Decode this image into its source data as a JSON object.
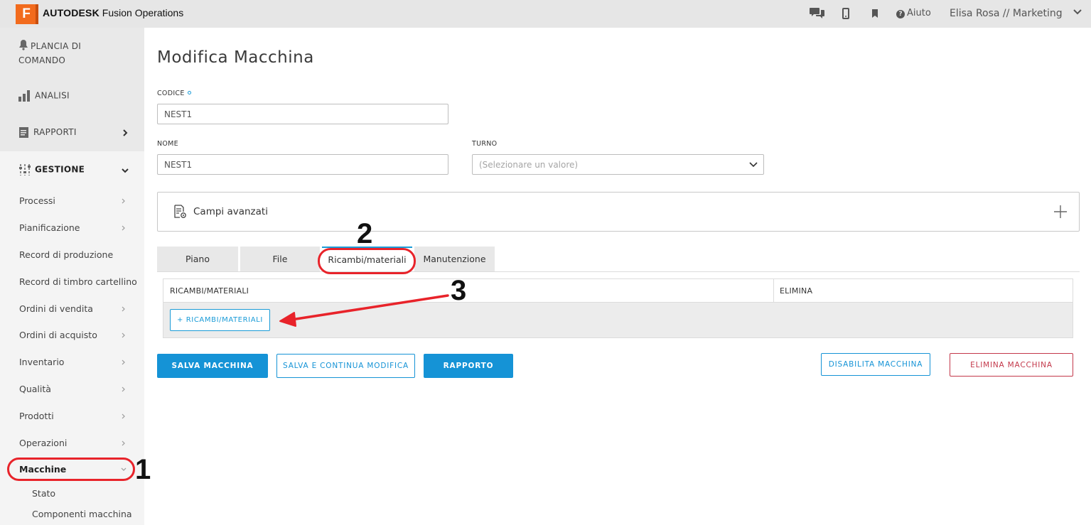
{
  "app": {
    "logo_letter": "F",
    "brand_bold": "AUTODESK",
    "brand_rest": " Fusion Operations",
    "help_label": "Aiuto",
    "user_label": "Elisa Rosa // Marketing"
  },
  "sidebar": {
    "sections": [
      {
        "label_line1": "PLANCIA DI",
        "label_line2": "COMANDO",
        "icon": "bell-icon"
      },
      {
        "label": "ANALISI",
        "icon": "bar-chart-icon"
      },
      {
        "label": "RAPPORTI",
        "icon": "report-icon"
      },
      {
        "label": "GESTIONE",
        "icon": "sliders-icon"
      }
    ],
    "items": [
      {
        "label": "Processi"
      },
      {
        "label": "Pianificazione"
      },
      {
        "label": "Record di produzione"
      },
      {
        "label": "Record di timbro cartellino"
      },
      {
        "label": "Ordini di vendita"
      },
      {
        "label": "Ordini di acquisto"
      },
      {
        "label": "Inventario"
      },
      {
        "label": "Qualità"
      },
      {
        "label": "Prodotti"
      },
      {
        "label": "Operazioni"
      },
      {
        "label": "Macchine"
      }
    ],
    "subitems": [
      {
        "label": "Stato"
      },
      {
        "label": "Componenti macchina"
      }
    ]
  },
  "main": {
    "title": "Modifica Macchina",
    "codice_label": "CODICE",
    "codice_value": "NEST1",
    "nome_label": "NOME",
    "nome_value": "NEST1",
    "turno_label": "TURNO",
    "turno_placeholder": "(Selezionare un valore)",
    "advanced_label": "Campi avanzati",
    "tabs": [
      {
        "label": "Piano"
      },
      {
        "label": "File"
      },
      {
        "label": "Ricambi/materiali"
      },
      {
        "label": "Manutenzione"
      }
    ],
    "table": {
      "col1": "RICAMBI/MATERIALI",
      "col2": "ELIMINA",
      "add_label": "+ RICAMBI/MATERIALI"
    },
    "buttons": {
      "save": "SALVA MACCHINA",
      "save_continue": "SALVA E CONTINUA MODIFICA",
      "report": "RAPPORTO",
      "disable": "DISABILITA MACCHINA",
      "delete": "ELIMINA MACCHINA"
    }
  },
  "annotations": {
    "step1": "1",
    "step2": "2",
    "step3": "3"
  },
  "colors": {
    "accent": "#1593d6",
    "brand_orange": "#f26b1d",
    "danger": "#c3384a",
    "annotation_red": "#e8232a"
  }
}
